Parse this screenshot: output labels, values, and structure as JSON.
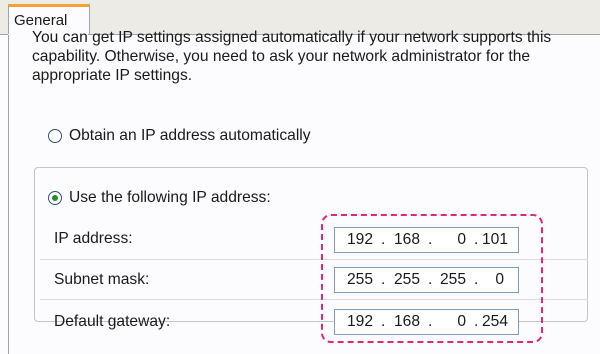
{
  "tabs": [
    {
      "label": "General"
    }
  ],
  "description": "You can get IP settings assigned automatically if your network supports this capability. Otherwise, you need to ask your network administrator for the appropriate IP settings.",
  "options": {
    "auto_label": "Obtain an IP address automatically",
    "manual_label": "Use the following IP address:",
    "selected": "manual"
  },
  "fields": [
    {
      "label": "IP address:",
      "octets": [
        "192",
        "168",
        "0",
        "101"
      ]
    },
    {
      "label": "Subnet mask:",
      "octets": [
        "255",
        "255",
        "255",
        "0"
      ]
    },
    {
      "label": "Default gateway:",
      "octets": [
        "192",
        "168",
        "0",
        "254"
      ]
    }
  ],
  "colors": {
    "tab_accent": "#f2a23a",
    "highlight": "#e0287a",
    "radio_dot": "#2a8d2a"
  }
}
